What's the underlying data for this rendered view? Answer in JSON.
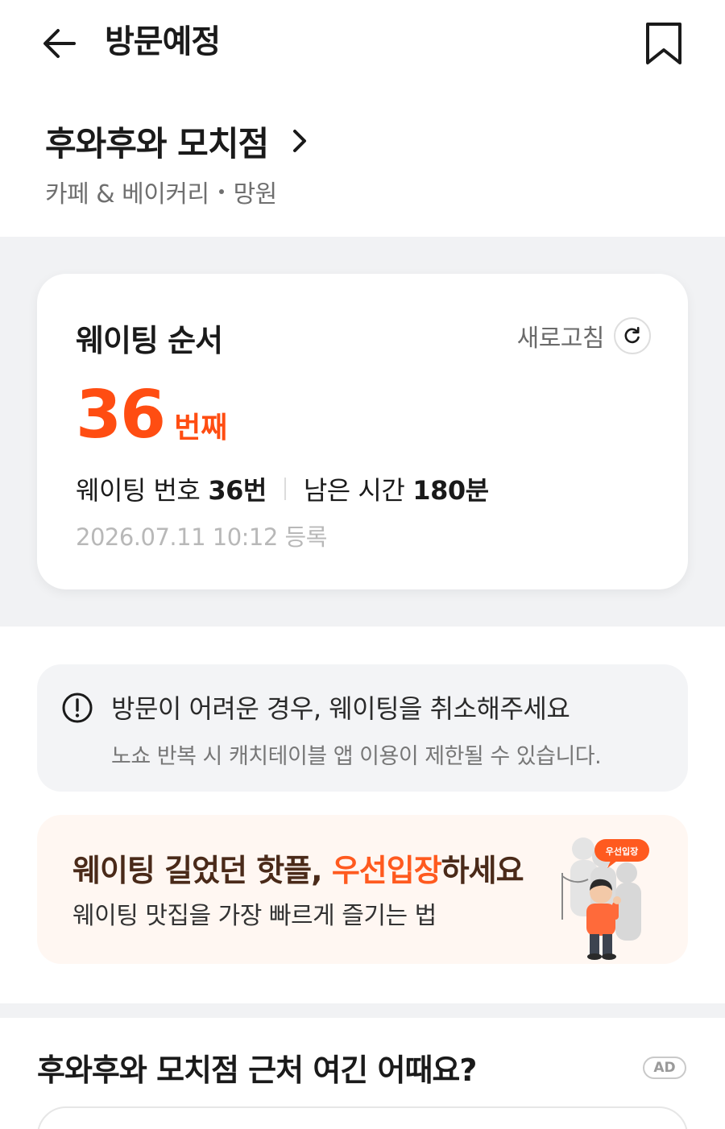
{
  "header": {
    "title": "방문예정",
    "back_icon": "arrow-left-icon",
    "bookmark_icon": "bookmark-icon"
  },
  "store": {
    "name": "후와후와 모치점",
    "category": "카페 & 베이커리",
    "area": "망원"
  },
  "waiting": {
    "title": "웨이팅 순서",
    "refresh_label": "새로고침",
    "queue_number": "36",
    "queue_unit": "번째",
    "number_label": "웨이팅 번호",
    "number_value": "36번",
    "remaining_label": "남은 시간",
    "remaining_value": "180분",
    "registered": "2026.07.11 10:12 등록",
    "accent_color": "#ff4d12"
  },
  "notice": {
    "title": "방문이 어려운 경우, 웨이팅을 취소해주세요",
    "subtitle": "노쇼 반복 시 캐치테이블 앱 이용이 제한될 수 있습니다.",
    "icon": "alert-circle-icon"
  },
  "promo": {
    "title_pre": "웨이팅 길었던 핫플, ",
    "title_highlight": "우선입장",
    "title_post": "하세요",
    "subtitle": "웨이팅 맛집을 가장 빠르게 즐기는 법",
    "bubble": "우선입장"
  },
  "nearby": {
    "title": "후와후와 모치점 근처 여긴 어때요?",
    "ad_label": "AD"
  }
}
